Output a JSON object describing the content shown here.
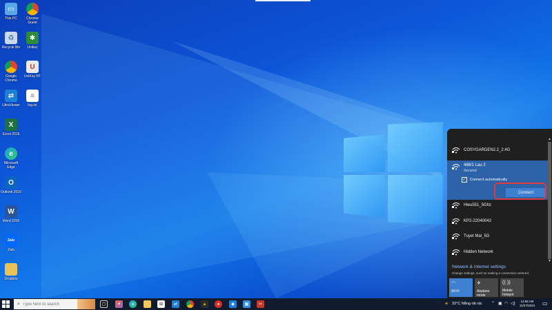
{
  "desktop": {
    "icons": [
      {
        "label": "This PC",
        "icon": "monitor-icon",
        "color": "#5aa7e8"
      },
      {
        "label": "Recycle Bin",
        "icon": "recycle-bin-icon",
        "color": "#c9d9ea"
      },
      {
        "label": "Google Chrome",
        "icon": "chrome-icon",
        "color": "#db4437"
      },
      {
        "label": "UltraViewer",
        "icon": "ultraviewer-icon",
        "color": "#1f7fd6"
      },
      {
        "label": "Excel 2016",
        "icon": "excel-icon",
        "color": "#1d7044"
      },
      {
        "label": "Microsoft Edge",
        "icon": "edge-icon",
        "color": "#1aa1d6"
      },
      {
        "label": "Outlook 2016",
        "icon": "outlook-icon",
        "color": "#0a64c2"
      },
      {
        "label": "Word 2016",
        "icon": "word-icon",
        "color": "#2a5699"
      },
      {
        "label": "Zalo",
        "icon": "zalo-icon",
        "color": "#0068ff"
      },
      {
        "label": "Dropbox",
        "icon": "folder-icon",
        "color": "#e8c35a"
      },
      {
        "label": "Chrome Guest",
        "icon": "chrome-icon",
        "color": "#db4437"
      },
      {
        "label": "Unikey",
        "icon": "unikey-icon",
        "color": "#2d8c3c"
      },
      {
        "label": "UniKey NT",
        "icon": "unikey-nt-icon",
        "color": "#e9e9e9"
      },
      {
        "label": "log.txt",
        "icon": "text-file-icon",
        "color": "#ffffff"
      }
    ]
  },
  "wifi_flyout": {
    "networks": [
      {
        "name": "COSYGARDEN2.2_2.4G",
        "icon": "wifi-secured-icon"
      },
      {
        "name": "Hieu551_5Ghz",
        "icon": "wifi-secured-icon"
      },
      {
        "name": "KP2-22040042",
        "icon": "wifi-secured-icon"
      },
      {
        "name": "Tuyet Mai_5G",
        "icon": "wifi-secured-icon"
      },
      {
        "name": "Hidden Network",
        "icon": "wifi-secured-icon"
      }
    ],
    "selected": {
      "name": "488/1 Lau 2",
      "status": "Secured",
      "auto_connect_label": "Connect automatically",
      "auto_connect_checked": "✓",
      "connect_label": "Connect"
    },
    "settings_title": "Network & Internet settings",
    "settings_subtitle": "Change settings, such as making a connection metered.",
    "quick_actions": [
      {
        "label": "Wi-Fi",
        "icon": "wifi-icon",
        "active": true
      },
      {
        "label": "Airplane mode",
        "icon": "airplane-icon",
        "active": false
      },
      {
        "label": "Mobile hotspot",
        "icon": "hotspot-icon",
        "active": false
      }
    ]
  },
  "taskbar": {
    "search_placeholder": "Type here to search",
    "weather": "32°C  Nắng rải rác",
    "time": "11:56 AM",
    "date": "11/27/2024"
  },
  "colors": {
    "accent": "#2c62a8",
    "button": "#3d7fd1",
    "highlight": "#e0393e",
    "flyout_bg": "#1f1f1f"
  }
}
